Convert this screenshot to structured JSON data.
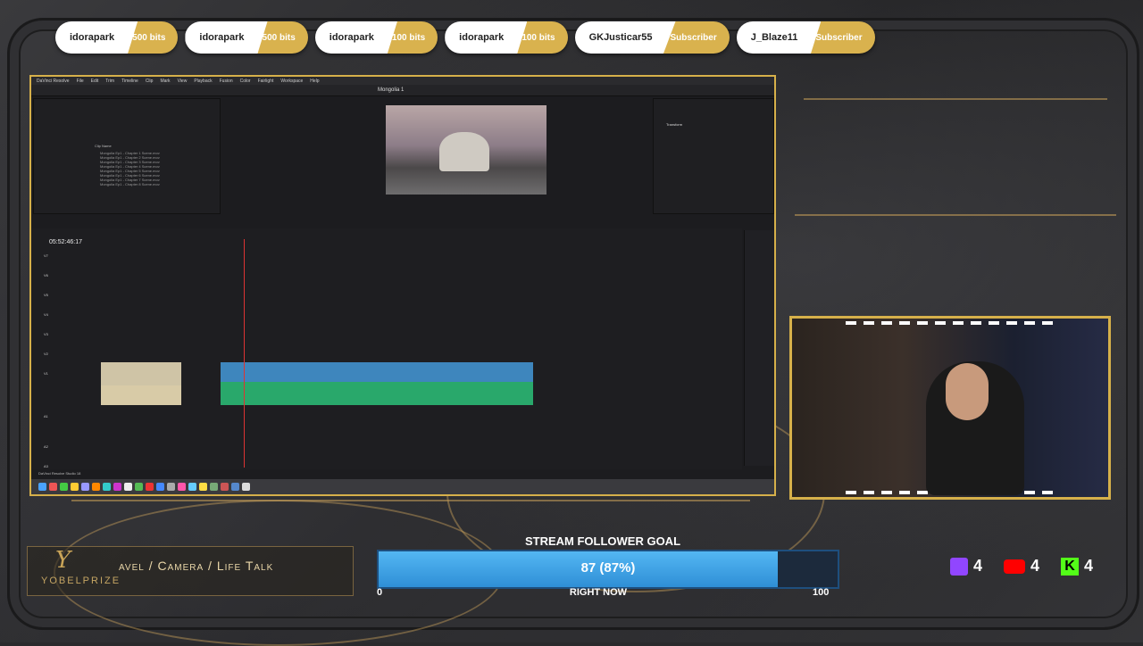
{
  "alerts": [
    {
      "name": "idorapark",
      "amount": "500 bits"
    },
    {
      "name": "idorapark",
      "amount": "500 bits"
    },
    {
      "name": "idorapark",
      "amount": "100 bits"
    },
    {
      "name": "idorapark",
      "amount": "100 bits"
    },
    {
      "name": "GKJusticar55",
      "amount": "Subscriber"
    },
    {
      "name": "J_Blaze11",
      "amount": "Subscriber"
    }
  ],
  "resolve": {
    "menu": [
      "DaVinci Resolve",
      "File",
      "Edit",
      "Trim",
      "Timeline",
      "Clip",
      "Mark",
      "View",
      "Playback",
      "Fusion",
      "Color",
      "Fairlight",
      "Workspace",
      "Help"
    ],
    "project_title": "Mongolia 1",
    "timecode": "05:52:46:17",
    "app_label": "DaVinci Resolve Studio 18",
    "clip_header": "Clip Name",
    "clips": [
      "Mongolia Ep1 - Chapter 1 Scene.mov",
      "Mongolia Ep1 - Chapter 2 Scene.mov",
      "Mongolia Ep1 - Chapter 3 Scene.mov",
      "Mongolia Ep1 - Chapter 4 Scene.mov",
      "Mongolia Ep1 - Chapter 5 Scene.mov",
      "Mongolia Ep1 - Chapter 6 Scene.mov",
      "Mongolia Ep1 - Chapter 7 Scene.mov",
      "Mongolia Ep1 - Chapter 8 Scene.mov"
    ],
    "tracks": [
      "V7",
      "V6",
      "V5",
      "V4",
      "V3",
      "V2",
      "V1",
      "A1",
      "A2",
      "A3"
    ],
    "inspector_title": "Transform"
  },
  "branding": {
    "name": "YOBELPRIZE",
    "tagline": "avel / Camera / Life Talk"
  },
  "goal": {
    "title": "STREAM FOLLOWER GOAL",
    "value_text": "87 (87%)",
    "progress": 0.87,
    "min": "0",
    "max": "100",
    "subtitle": "RIGHT NOW"
  },
  "social": {
    "twitch": "4",
    "youtube": "4",
    "kick": "4"
  },
  "colors": {
    "accent_gold": "#d6b04a",
    "goal_blue": "#53b7f3"
  }
}
